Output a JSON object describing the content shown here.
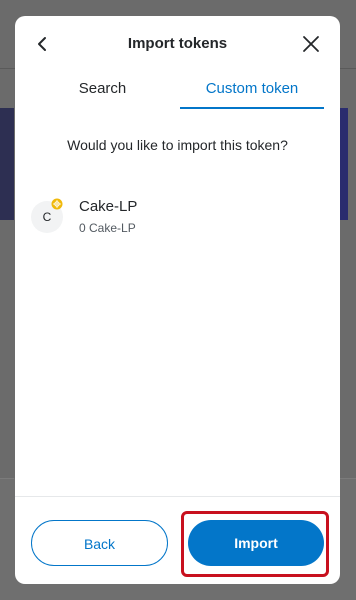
{
  "modal": {
    "title": "Import tokens"
  },
  "tabs": {
    "search": "Search",
    "custom": "Custom token"
  },
  "prompt": "Would you like to import this token?",
  "token": {
    "avatar_letter": "C",
    "name": "Cake-LP",
    "balance": "0 Cake-LP"
  },
  "buttons": {
    "back": "Back",
    "import": "Import"
  },
  "colors": {
    "accent": "#0376c9",
    "highlight": "#c8101e",
    "badge": "#f0b90b"
  },
  "icons": {
    "back": "chevron-left-icon",
    "close": "close-icon",
    "badge": "network-badge-icon"
  }
}
